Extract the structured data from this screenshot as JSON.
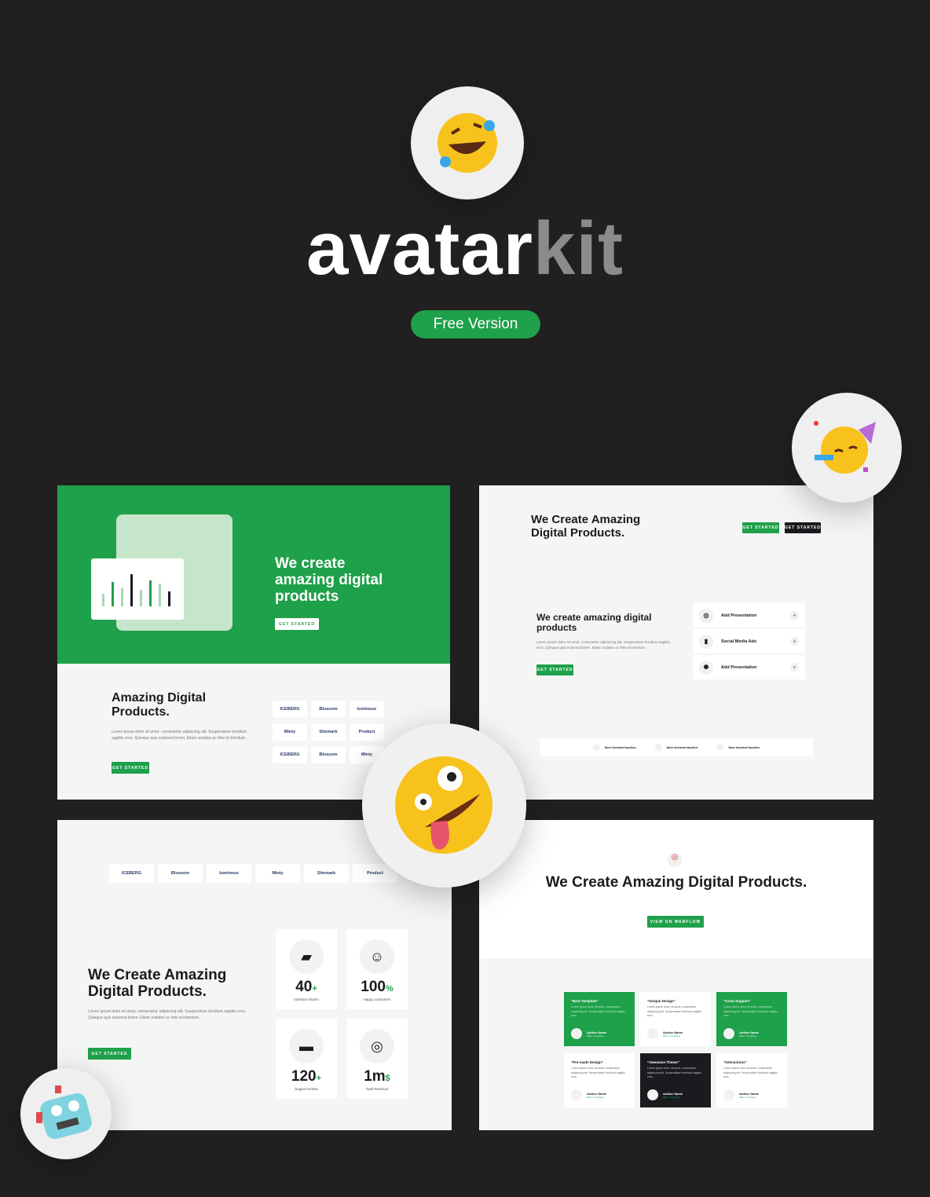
{
  "brand": {
    "name_part1": "avatar",
    "name_part2": "kit",
    "badge": "Free Version"
  },
  "colors": {
    "background": "#221f20",
    "accent": "#1fa04a",
    "dark": "#1b1b1f",
    "kit_gray": "#8c8b8c"
  },
  "icons": {
    "hero": "rolling-on-floor-laughing-emoji",
    "top_right": "partying-face-emoji",
    "center": "zany-face-emoji",
    "bottom_left": "robot-emoji"
  },
  "card1": {
    "hero_title": "We create amazing digital products",
    "hero_button": "GET STARTED",
    "title": "Amazing Digital Products.",
    "body": "Lorem ipsum dolor sit amet, consectetur adipiscing elit. Suspendisse tincidunt sagittis eros. Quisque quis euismod lorem. Etiam sodales ac felis id interdum.",
    "button": "GET STARTED",
    "logos": [
      "ICEBERG",
      "Blossom",
      "luminous",
      "Minty",
      "Sitemark",
      "Product",
      "ICEBERG",
      "Blossom",
      "Minty"
    ]
  },
  "card2": {
    "title": "We Create Amazing Digital Products.",
    "button1": "GET STARTED",
    "button2": "GET STARTED",
    "subtitle": "We create amazing digital products",
    "body": "Lorem ipsum dolor sit amet, consectetur adipiscing elit. Suspendisse tincidunt sagittis eros. Quisque quis euismod lorem. Etiam sodales ac felis id interdum.",
    "button": "GET STARTED",
    "items": [
      "Add Presentation",
      "Social Media Ads",
      "Add Presentation"
    ],
    "features": [
      "Nunc tincidunt faucibus",
      "Nunc tincidunt faucibus",
      "Nunc tincidunt faucibus"
    ]
  },
  "card3": {
    "logos": [
      "ICEBERG",
      "Blossom",
      "luminous",
      "Minty",
      "Sitemark",
      "Product"
    ],
    "title": "We Create Amazing Digital Products.",
    "body": "Lorem ipsum dolor sit amet, consectetur adipiscing elit. Suspendisse tincidunt sagittis eros. Quisque quis euismod lorem. Etiam sodales ac felis id interdum.",
    "button": "GET STARTED",
    "stats": [
      {
        "num": "40",
        "suffix": "+",
        "label": "Interface blocks"
      },
      {
        "num": "100",
        "suffix": "%",
        "label": "Happy customers"
      },
      {
        "num": "120",
        "suffix": "+",
        "label": "Support tickets"
      },
      {
        "num": "1m",
        "suffix": "$",
        "label": "Total Revenue"
      }
    ]
  },
  "card4": {
    "title": "We Create Amazing Digital Products.",
    "button": "VIEW ON WEBFLOW",
    "testimonials": [
      {
        "quote": "\"Best Template\"",
        "text": "Lorem ipsum dolor sit amet, consectetur adipiscing elit. Suspendisse tincidunt sagittis eros.",
        "author": "Author Name",
        "role": "CEO / Company"
      },
      {
        "quote": "\"Unique Design\"",
        "text": "Lorem ipsum dolor sit amet, consectetur adipiscing elit. Suspendisse tincidunt sagittis eros.",
        "author": "Author Name",
        "role": "CEO / Company"
      },
      {
        "quote": "\"Great Support\"",
        "text": "Lorem ipsum dolor sit amet, consectetur adipiscing elit. Suspendisse tincidunt sagittis eros.",
        "author": "Author Name",
        "role": "CEO / Company"
      },
      {
        "quote": "\"Pre-made Design\"",
        "text": "Lorem ipsum dolor sit amet, consectetur adipiscing elit. Suspendisse tincidunt sagittis eros.",
        "author": "Author Name",
        "role": "CEO / Company"
      },
      {
        "quote": "\"Awesome Theme\"",
        "text": "Lorem ipsum dolor sit amet, consectetur adipiscing elit. Suspendisse tincidunt sagittis eros.",
        "author": "Author Name",
        "role": "CEO / Company"
      },
      {
        "quote": "\"Interactions\"",
        "text": "Lorem ipsum dolor sit amet, consectetur adipiscing elit. Suspendisse tincidunt sagittis eros.",
        "author": "Author Name",
        "role": "CEO / Company"
      }
    ]
  }
}
